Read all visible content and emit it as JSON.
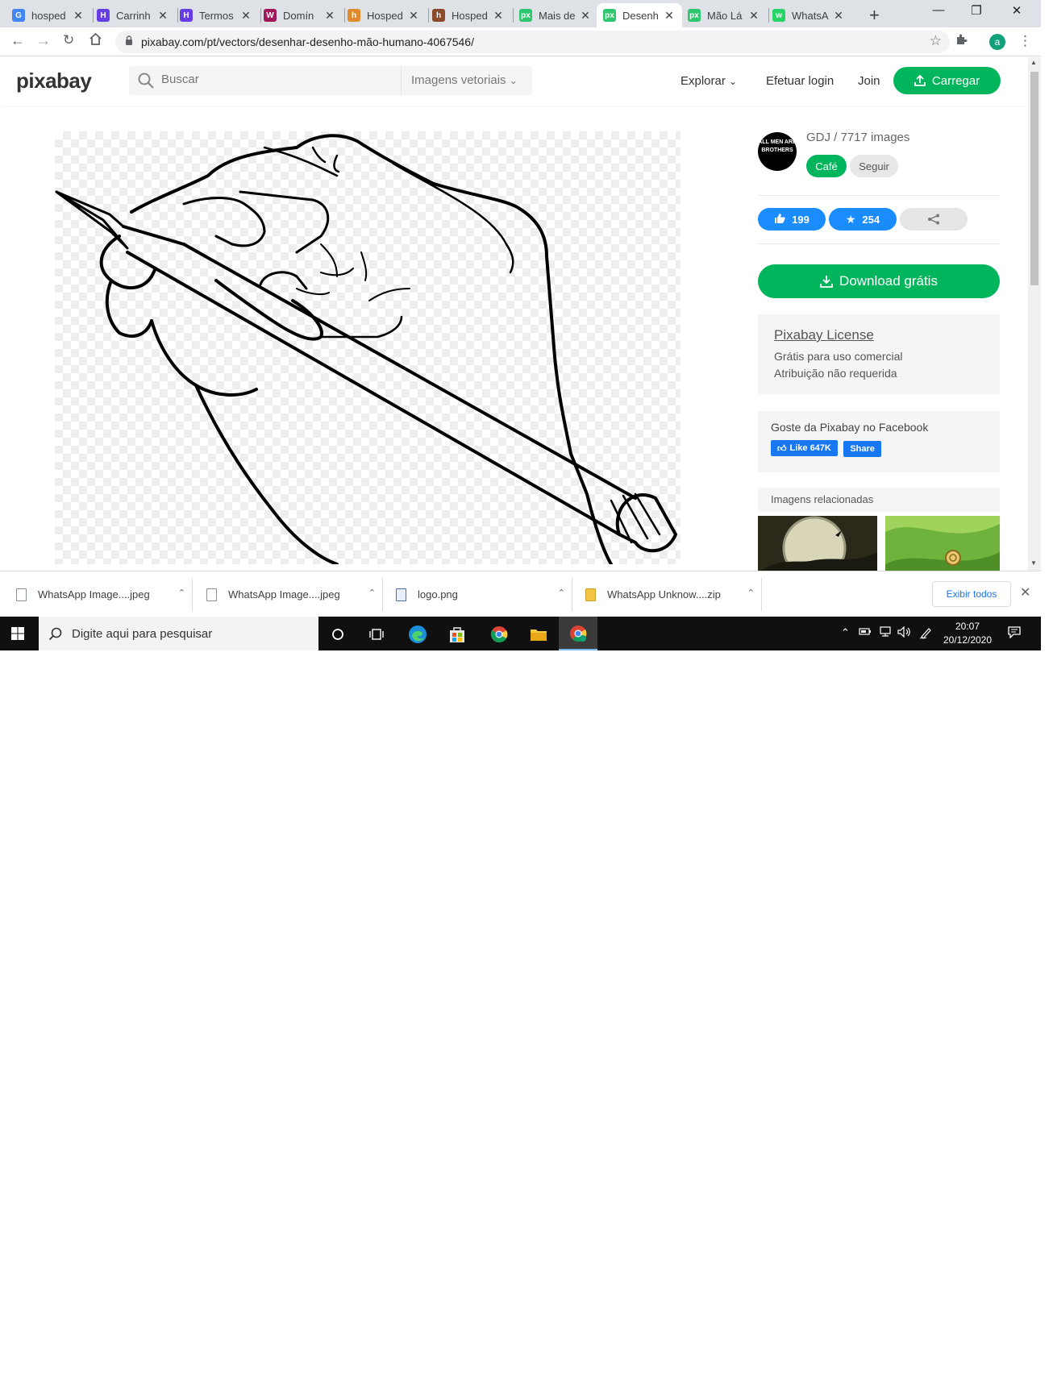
{
  "tabs": [
    {
      "title": "hosped",
      "icon": "google-icon",
      "color": "#4285f4",
      "glyph": "G"
    },
    {
      "title": "Carrinh",
      "icon": "hostinger-icon",
      "color": "#673de6",
      "glyph": "H"
    },
    {
      "title": "Termos",
      "icon": "hostinger-icon",
      "color": "#673de6",
      "glyph": "H"
    },
    {
      "title": "Domín",
      "icon": "w-icon",
      "color": "#a1185a",
      "glyph": "W"
    },
    {
      "title": "Hosped",
      "icon": "site-icon",
      "color": "#e08a2c",
      "glyph": "h"
    },
    {
      "title": "Hosped",
      "icon": "site-icon",
      "color": "#8a4a2a",
      "glyph": "h"
    },
    {
      "title": "Mais de",
      "icon": "pixabay-icon",
      "color": "#2ec66e",
      "glyph": "px"
    },
    {
      "title": "Desenh",
      "icon": "pixabay-icon",
      "color": "#2ec66e",
      "glyph": "px"
    },
    {
      "title": "Mão Lá",
      "icon": "pixabay-icon",
      "color": "#2ec66e",
      "glyph": "px"
    },
    {
      "title": "WhatsA",
      "icon": "whatsapp-icon",
      "color": "#25d366",
      "glyph": "w"
    }
  ],
  "active_tab_index": 7,
  "address": {
    "url": "pixabay.com/pt/vectors/desenhar-desenho-mão-humano-4067546/"
  },
  "profile_initial": "a",
  "header": {
    "logo": "pixabay",
    "search_placeholder": "Buscar",
    "search_type": "Imagens vetoriais",
    "nav_explore": "Explorar",
    "nav_login": "Efetuar login",
    "nav_join": "Join",
    "upload_label": "Carregar"
  },
  "image": {
    "subject": "hand-drawing-with-pencil"
  },
  "author": {
    "avatar_text": "ALL MEN ARE BROTHERS",
    "name_line": "GDJ / 7717 images",
    "coffee_label": "Café",
    "follow_label": "Seguir"
  },
  "stats": {
    "likes": "199",
    "favorites": "254"
  },
  "download_label": "Download grátis",
  "license": {
    "title": "Pixabay License",
    "line1": "Grátis para uso comercial",
    "line2": "Atribuição não requerida"
  },
  "facebook": {
    "title": "Goste da Pixabay no Facebook",
    "like_label": "Like 647K",
    "share_label": "Share"
  },
  "related_title": "Imagens relacionadas",
  "downloads": [
    {
      "name": "WhatsApp Image....jpeg",
      "type": "jpeg"
    },
    {
      "name": "WhatsApp Image....jpeg",
      "type": "jpeg"
    },
    {
      "name": "logo.png",
      "type": "png"
    },
    {
      "name": "WhatsApp Unknow....zip",
      "type": "zip"
    }
  ],
  "show_all_label": "Exibir todos",
  "taskbar": {
    "search_placeholder": "Digite aqui para pesquisar",
    "time": "20:07",
    "date": "20/12/2020"
  }
}
